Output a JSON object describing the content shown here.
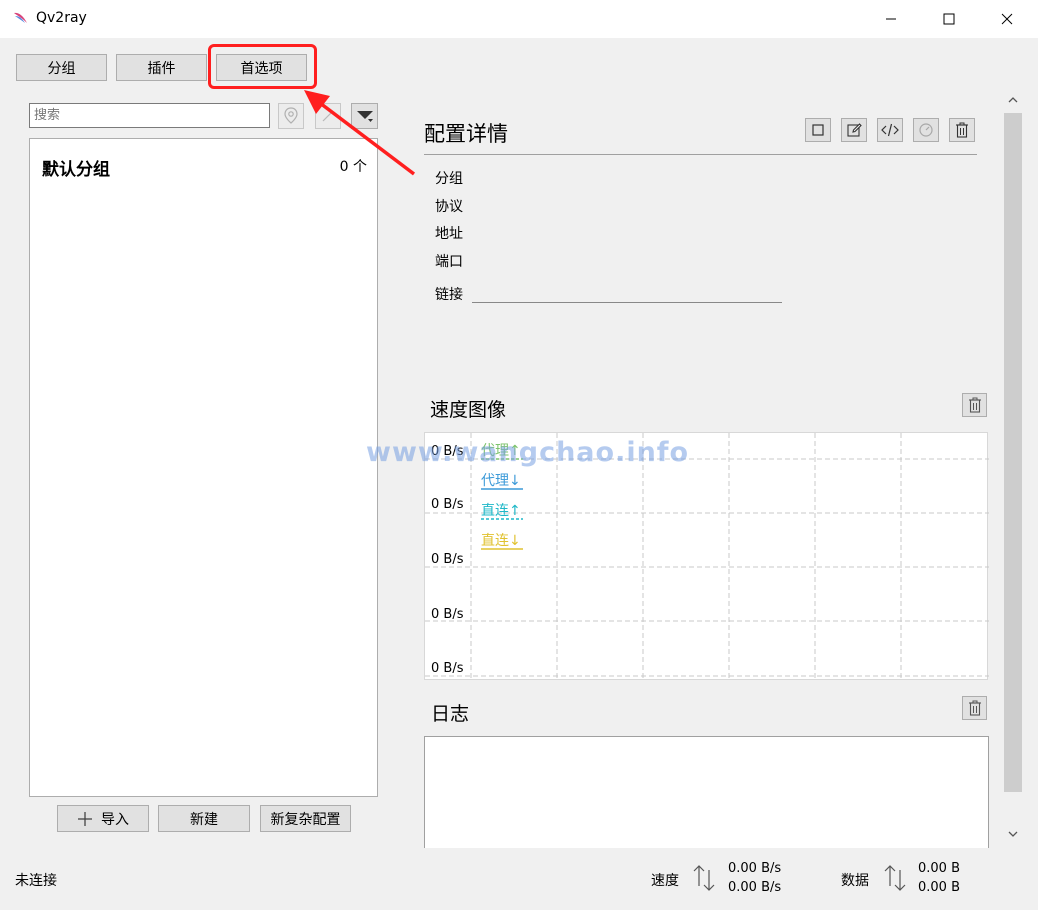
{
  "window": {
    "title": "Qv2ray"
  },
  "top_buttons": {
    "group": "分组",
    "plugin": "插件",
    "preferences": "首选项"
  },
  "search": {
    "placeholder": "搜索"
  },
  "group_list": {
    "items": [
      {
        "name": "默认分组",
        "count": "0 个"
      }
    ]
  },
  "bottom_buttons": {
    "import": "导入",
    "new": "新建",
    "complex": "新复杂配置"
  },
  "config_details": {
    "title": "配置详情",
    "labels": {
      "group": "分组",
      "protocol": "协议",
      "address": "地址",
      "port": "端口",
      "link": "链接"
    }
  },
  "speed_chart": {
    "title": "速度图像"
  },
  "chart_data": {
    "type": "line",
    "title": "",
    "y_tick_labels": [
      "0 B/s",
      "0 B/s",
      "0 B/s",
      "0 B/s",
      "0 B/s"
    ],
    "grid": true,
    "legend_placement": "top-left",
    "series": [
      {
        "name": "代理↑",
        "values": [
          0
        ],
        "color": "#7cc36b"
      },
      {
        "name": "代理↓",
        "values": [
          0
        ],
        "color": "#3c9ad8"
      },
      {
        "name": "直连↑",
        "values": [
          0
        ],
        "color": "#1fb8c8"
      },
      {
        "name": "直连↓",
        "values": [
          0
        ],
        "color": "#e0c230"
      }
    ]
  },
  "log": {
    "title": "日志"
  },
  "status_bar": {
    "connection": "未连接",
    "speed_label": "速度",
    "speed_up": "0.00 B/s",
    "speed_down": "0.00 B/s",
    "data_label": "数据",
    "data_up": "0.00 B",
    "data_down": "0.00 B"
  },
  "watermark": "www.wangchao.info",
  "colors": {
    "annotation": "#ff1f1f",
    "window_bg": "#f0f0f0"
  }
}
